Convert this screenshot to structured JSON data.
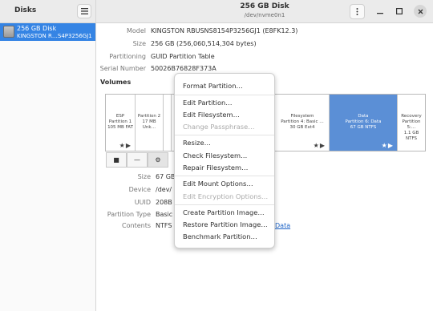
{
  "sidebar": {
    "title": "Disks",
    "items": [
      {
        "name": "256 GB Disk",
        "subtitle": "KINGSTON R…S4P3256GJ1"
      }
    ]
  },
  "header": {
    "title": "256 GB Disk",
    "subtitle": "/dev/nvme0n1"
  },
  "disk_info": {
    "model_label": "Model",
    "model": "KINGSTON RBUSNS8154P3256GJ1 (E8FK12.3)",
    "size_label": "Size",
    "size": "256 GB (256,060,514,304 bytes)",
    "partitioning_label": "Partitioning",
    "partitioning": "GUID Partition Table",
    "serial_label": "Serial Number",
    "serial": "50026B76828F373A"
  },
  "volumes": {
    "heading": "Volumes",
    "partitions": [
      {
        "line1": "ESP",
        "line2": "Partition 1",
        "line3": "105 MB FAT",
        "marks": "★▶"
      },
      {
        "line1": "Partition 2",
        "line2": "17 MB Unk…",
        "line3": "",
        "marks": ""
      },
      {
        "line1": "Filesystem",
        "line2": "Partition 4: Basic …",
        "line3": "30 GB Ext4",
        "marks": "★▶"
      },
      {
        "line1": "Data",
        "line2": "Partition 6: Data",
        "line3": "67 GB NTFS",
        "marks": "★▶"
      },
      {
        "line1": "Recovery",
        "line2": "Partition 5:…",
        "line3": "1.1 GB NTFS",
        "marks": ""
      }
    ]
  },
  "toolbar": {
    "stop_icon": "■",
    "minus_icon": "—",
    "gears_icon": "⚙"
  },
  "details": {
    "size_label": "Size",
    "size": "67 GB",
    "device_label": "Device",
    "device": "/dev/",
    "uuid_label": "UUID",
    "uuid": "208B",
    "ptype_label": "Partition Type",
    "ptype": "Basic",
    "contents_label": "Contents",
    "contents": "NTFS",
    "contents_link": "Data"
  },
  "context_menu": {
    "items": [
      {
        "label": "Format Partition…",
        "enabled": true
      },
      {
        "label": "Edit Partition…",
        "enabled": true
      },
      {
        "label": "Edit Filesystem…",
        "enabled": true
      },
      {
        "label": "Change Passphrase…",
        "enabled": false
      },
      {
        "label": "Resize…",
        "enabled": true
      },
      {
        "label": "Check Filesystem…",
        "enabled": true
      },
      {
        "label": "Repair Filesystem…",
        "enabled": true
      },
      {
        "label": "Edit Mount Options…",
        "enabled": true
      },
      {
        "label": "Edit Encryption Options…",
        "enabled": false
      },
      {
        "label": "Create Partition Image…",
        "enabled": true
      },
      {
        "label": "Restore Partition Image…",
        "enabled": true
      },
      {
        "label": "Benchmark Partition…",
        "enabled": true
      }
    ]
  },
  "colors": {
    "accent": "#3584e4",
    "selected_partition": "#5b8fd6",
    "link": "#1c63c7"
  }
}
